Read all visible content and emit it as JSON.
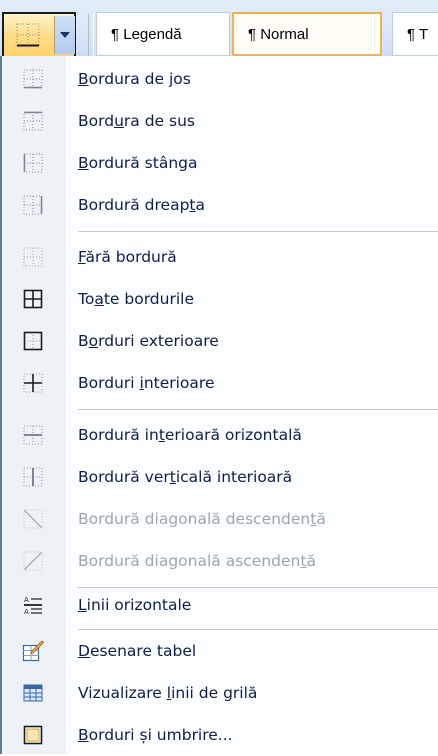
{
  "ribbon": {
    "styles": [
      {
        "label": "¶ Legendă"
      },
      {
        "label": "¶ Normal"
      },
      {
        "label": "¶ T"
      }
    ]
  },
  "colors": {
    "menu_text": "#0f1d4a",
    "disabled_text": "#9fa5ad",
    "selected_style_border": "#f0b24d"
  },
  "menu": {
    "items": [
      {
        "pre": "",
        "u": "B",
        "post": "ordura de jos",
        "icon": "bottom-border-icon"
      },
      {
        "pre": "Bord",
        "u": "u",
        "post": "ra de sus",
        "icon": "top-border-icon"
      },
      {
        "pre": "",
        "u": "B",
        "post": "ordură stânga",
        "icon": "left-border-icon"
      },
      {
        "pre": "Bordură dreap",
        "u": "t",
        "post": "a",
        "icon": "right-border-icon"
      },
      {
        "pre": "",
        "u": "F",
        "post": "ără bordură",
        "icon": "no-border-icon"
      },
      {
        "pre": "To",
        "u": "a",
        "post": "te bordurile",
        "icon": "all-borders-icon"
      },
      {
        "pre": "B",
        "u": "o",
        "post": "rduri exterioare",
        "icon": "outside-borders-icon"
      },
      {
        "pre": "Borduri ",
        "u": "i",
        "post": "nterioare",
        "icon": "inside-borders-icon"
      },
      {
        "pre": "Bordură in",
        "u": "t",
        "post": "erioară orizontală",
        "icon": "inside-horizontal-border-icon"
      },
      {
        "pre": "Bordură ver",
        "u": "t",
        "post": "icală interioară",
        "icon": "inside-vertical-border-icon"
      },
      {
        "pre": "Bordură diagonală descenden",
        "u": "t",
        "post": "ă",
        "icon": "diagonal-down-border-icon",
        "disabled": true
      },
      {
        "pre": "Bordură diagonală ascenden",
        "u": "t",
        "post": "ă",
        "icon": "diagonal-up-border-icon",
        "disabled": true
      },
      {
        "pre": "",
        "u": "L",
        "post": "inii orizontale",
        "icon": "horizontal-line-icon"
      },
      {
        "pre": "",
        "u": "D",
        "post": "esenare tabel",
        "icon": "draw-table-icon"
      },
      {
        "pre": "Vizualizare ",
        "u": "l",
        "post": "inii de grilă",
        "icon": "view-gridlines-icon"
      },
      {
        "pre": "",
        "u": "B",
        "post": "orduri și umbrire...",
        "icon": "borders-and-shading-icon"
      }
    ]
  }
}
